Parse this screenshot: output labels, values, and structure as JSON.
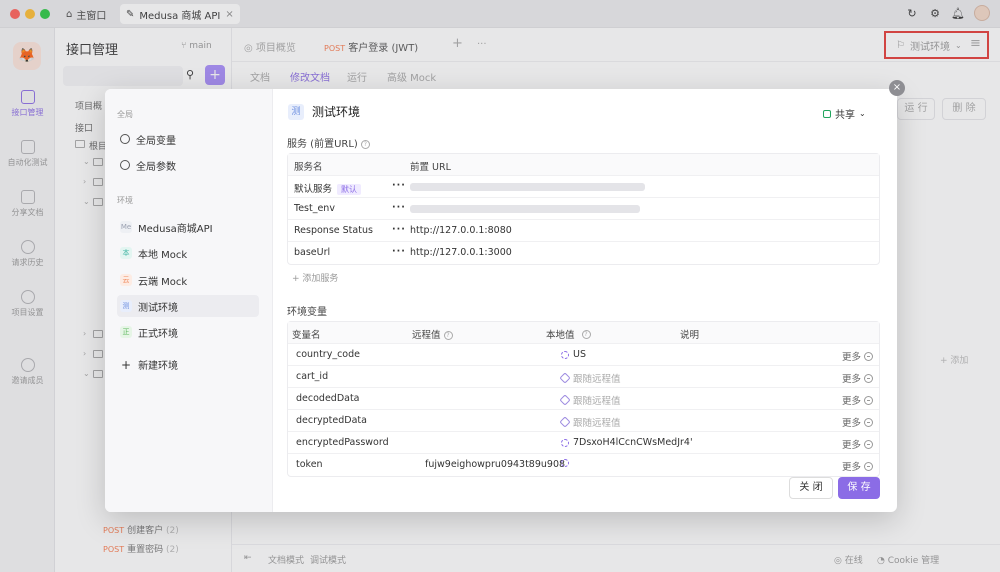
{
  "titlebar": {
    "home_tab": "主窗口",
    "doc_tab": "Medusa 商城 API"
  },
  "sidebar": {
    "items": [
      {
        "label": "接口管理",
        "icon": "api-icon"
      },
      {
        "label": "自动化测试",
        "icon": "test-icon"
      },
      {
        "label": "分享文档",
        "icon": "book-icon"
      },
      {
        "label": "请求历史",
        "icon": "clock-icon"
      },
      {
        "label": "项目设置",
        "icon": "gear-icon"
      },
      {
        "label": "邀请成员",
        "icon": "add-user-icon"
      }
    ]
  },
  "tree": {
    "title": "接口管理",
    "branch": "main",
    "rows": [
      "项目概",
      "接口",
      "根目",
      "商",
      "",
      "",
      "",
      "",
      "",
      "",
      "",
      "",
      "",
      "",
      "",
      "",
      "",
      "",
      "",
      "",
      ""
    ],
    "posts": [
      {
        "method": "POST",
        "label": "创建客户",
        "count": "(2)"
      },
      {
        "method": "POST",
        "label": "重置密码",
        "count": "(2)"
      }
    ]
  },
  "main": {
    "tabs": [
      "项目概览",
      "客户登录 (JWT)"
    ],
    "tab_method": "POST",
    "env_select": "测试环境",
    "subtabs": [
      "文档",
      "修改文档",
      "运行",
      "高级 Mock"
    ],
    "run": "运 行",
    "delete": "删 除",
    "add_param": "+ 添加",
    "bottom": {
      "doc_mode": "文档模式",
      "debug_mode": "调试模式",
      "online": "在线",
      "cookie": "Cookie 管理"
    }
  },
  "modal": {
    "global_section": "全局",
    "global_vars": "全局变量",
    "global_params": "全局参数",
    "env_section": "环境",
    "environments": [
      {
        "badge": "Me",
        "name": "Medusa商城API",
        "color": "#9aa0b0"
      },
      {
        "badge": "本",
        "name": "本地 Mock",
        "color": "#3fb5a3"
      },
      {
        "badge": "云",
        "name": "云端 Mock",
        "color": "#f08a5d"
      },
      {
        "badge": "测",
        "name": "测试环境",
        "color": "#6d8fe0"
      },
      {
        "badge": "正",
        "name": "正式环境",
        "color": "#5cb85c"
      }
    ],
    "new_env": "新建环境",
    "env_name": "测试环境",
    "env_badge": "测",
    "share": "共享",
    "services_title": "服务 (前置URL)",
    "services_headers": [
      "服务名",
      "前置 URL"
    ],
    "services": [
      {
        "name": "默认服务",
        "tag": "默认",
        "url": "",
        "blurred": true
      },
      {
        "name": "Test_env",
        "tag": "",
        "url": "",
        "blurred": true
      },
      {
        "name": "Response Status",
        "tag": "",
        "url": "http://127.0.0.1:8080",
        "blurred": false
      },
      {
        "name": "baseUrl",
        "tag": "",
        "url": "http://127.0.0.1:3000",
        "blurred": false
      }
    ],
    "add_service": "+ 添加服务",
    "vars_title": "环境变量",
    "vars_headers": [
      "变量名",
      "远程值",
      "本地值",
      "说明"
    ],
    "vars": [
      {
        "name": "country_code",
        "remote": "",
        "local": "US",
        "local_type": "sync",
        "more": "更多"
      },
      {
        "name": "cart_id",
        "remote": "",
        "local": "跟随远程值",
        "local_type": "follow",
        "more": "更多"
      },
      {
        "name": "decodedData",
        "remote": "",
        "local": "跟随远程值",
        "local_type": "follow",
        "more": "更多"
      },
      {
        "name": "decryptedData",
        "remote": "",
        "local": "跟随远程值",
        "local_type": "follow",
        "more": "更多"
      },
      {
        "name": "encryptedPassword",
        "remote": "",
        "local": "7DsxoH4lCcnCWsMedJr4'",
        "local_type": "sync",
        "more": "更多"
      },
      {
        "name": "token",
        "remote": "fujw9eighowpru0943t89u908",
        "local": "",
        "local_type": "sync",
        "more": "更多"
      }
    ],
    "close": "关 闭",
    "save": "保 存"
  },
  "colors": {
    "accent": "#8b6ce6",
    "highlight_border": "#e53935"
  }
}
